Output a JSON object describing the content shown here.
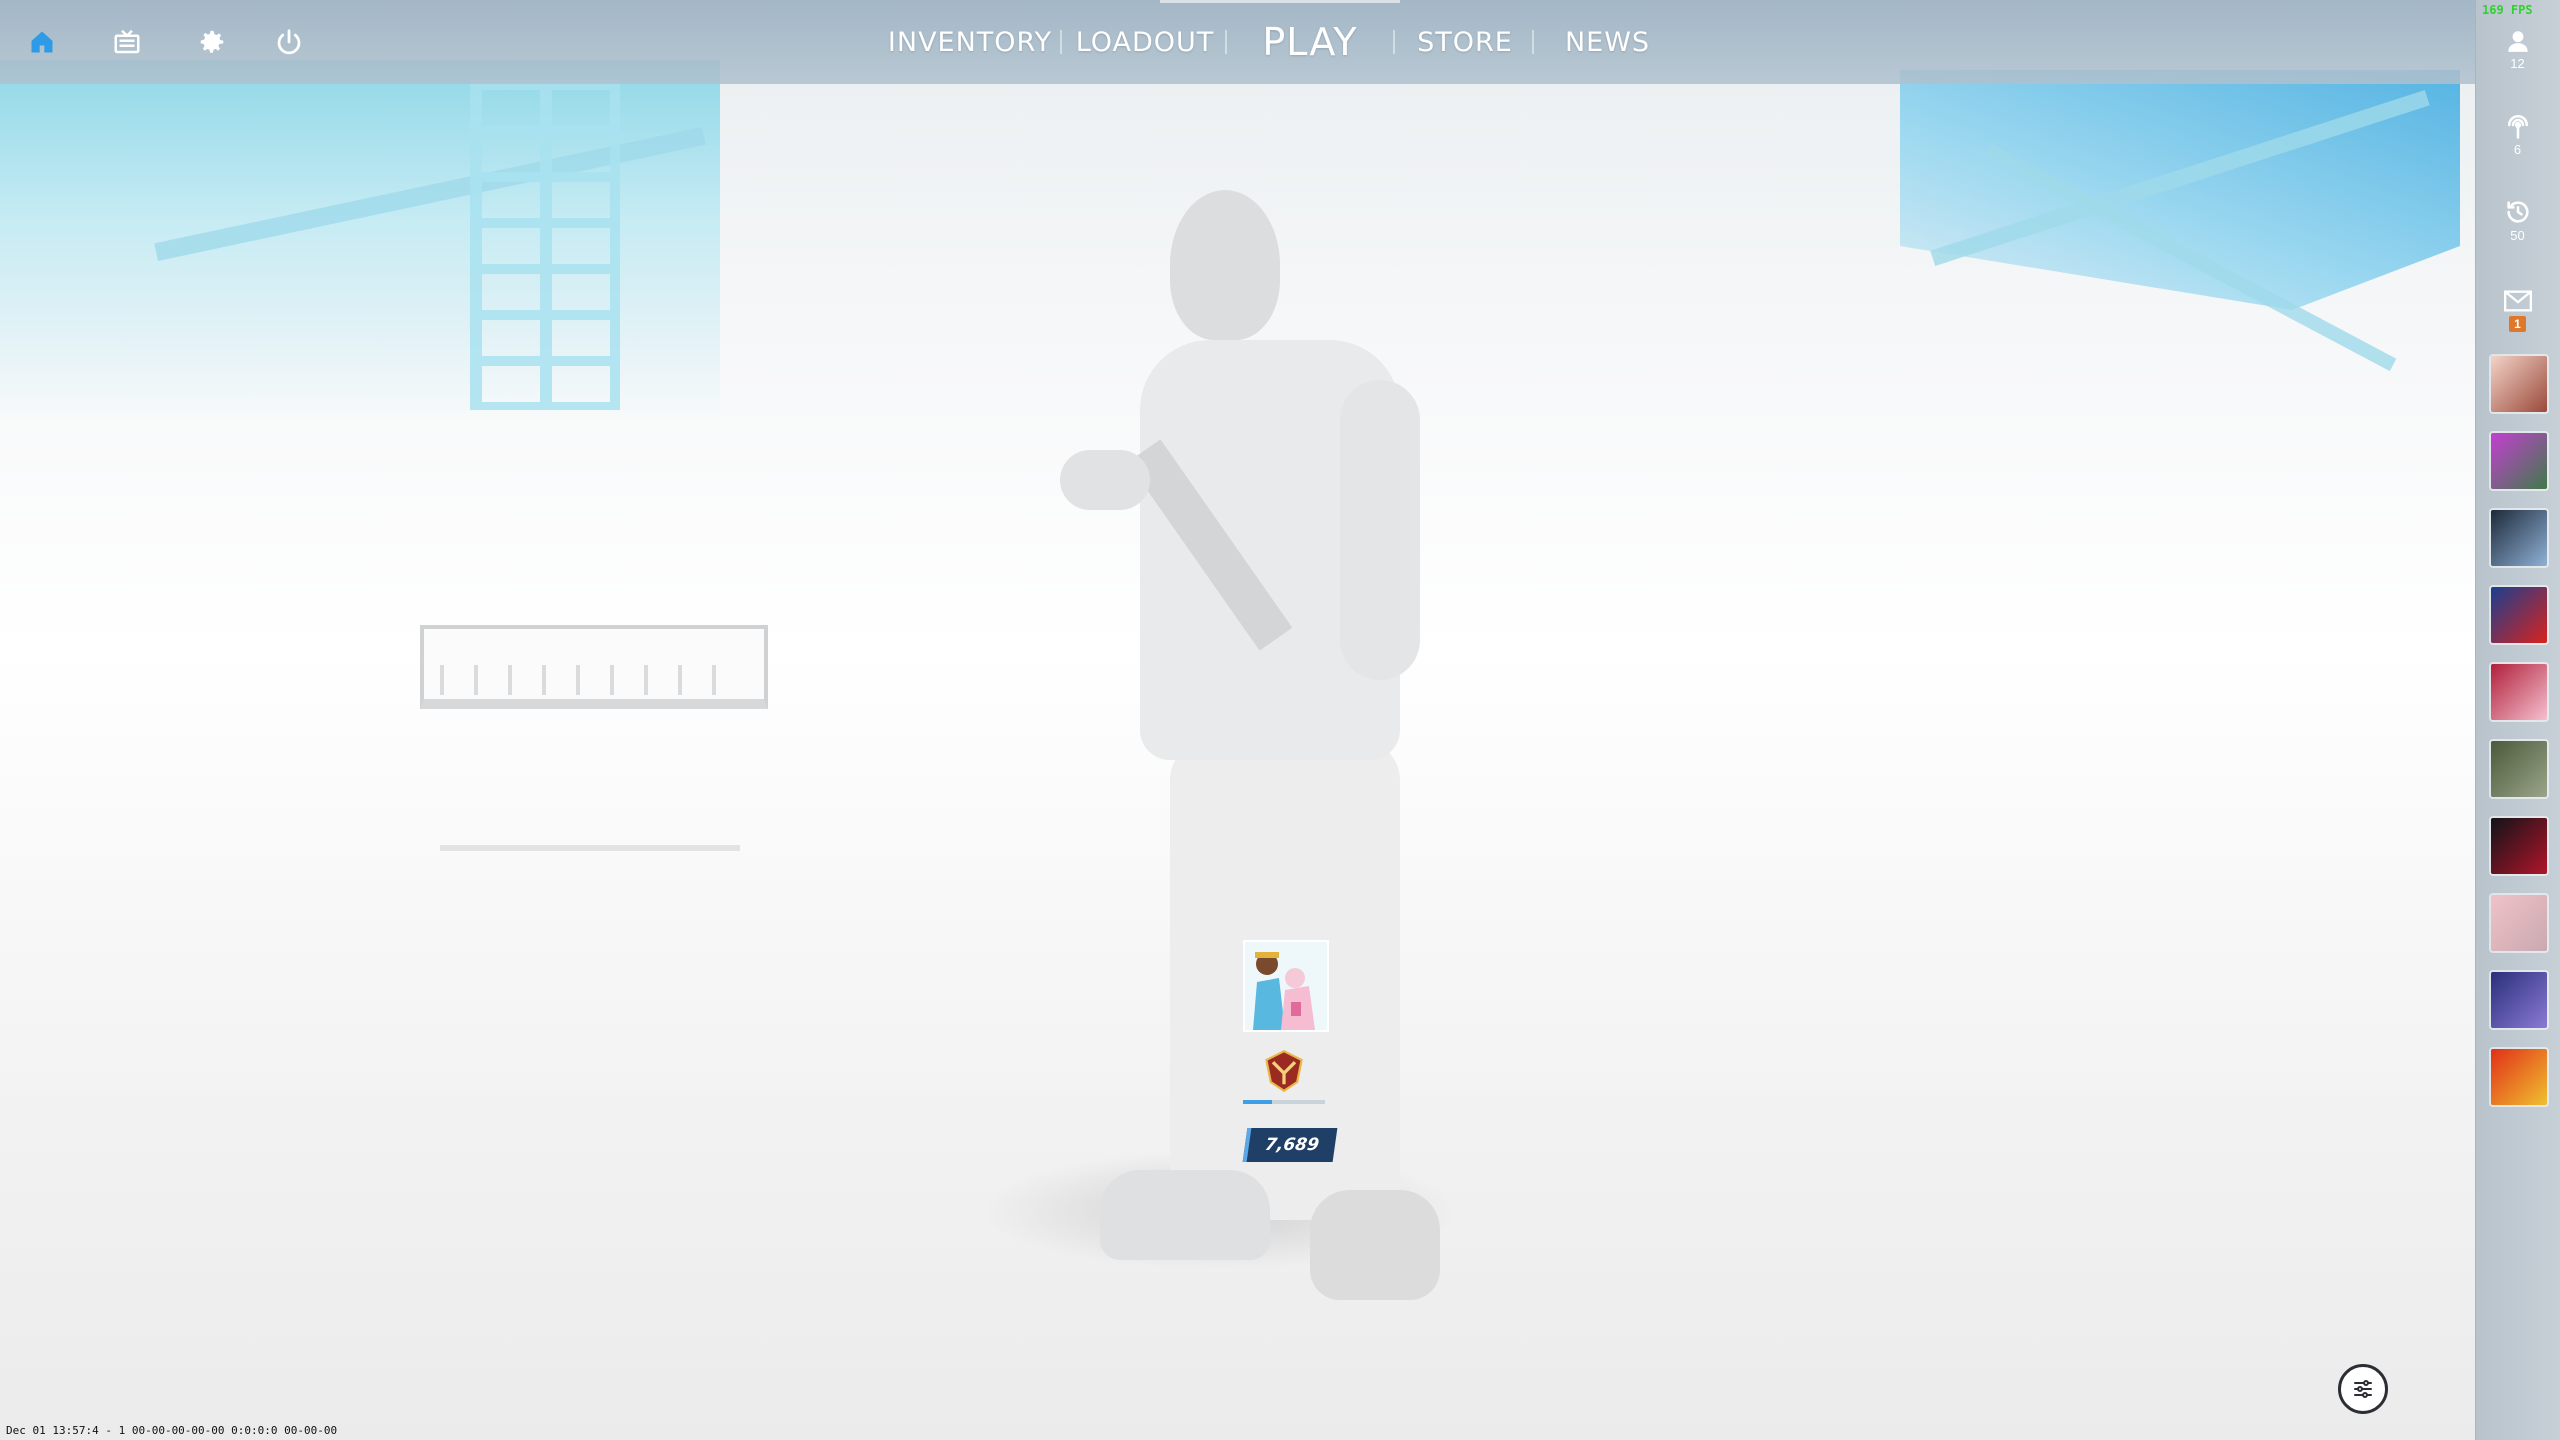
{
  "top_nav": {
    "left_icons": [
      "home-icon",
      "tv-icon",
      "gear-icon",
      "power-icon"
    ],
    "tabs": [
      {
        "label": "INVENTORY",
        "active": false
      },
      {
        "label": "LOADOUT",
        "active": false
      },
      {
        "label": "PLAY",
        "active": true
      },
      {
        "label": "STORE",
        "active": false
      },
      {
        "label": "NEWS",
        "active": false
      }
    ]
  },
  "right_rail": {
    "fps": "169 FPS",
    "friends": {
      "icon": "user-icon",
      "count": "12"
    },
    "party": {
      "icon": "broadcast-icon",
      "count": "6"
    },
    "history": {
      "icon": "history-icon",
      "count": "50"
    },
    "mail": {
      "icon": "mail-icon",
      "badge": "1"
    },
    "avatars": [
      {
        "colors": [
          "#f3d3c8",
          "#9a4a3a"
        ]
      },
      {
        "colors": [
          "#c43fd1",
          "#3f7a4a"
        ]
      },
      {
        "colors": [
          "#1d2a3a",
          "#8fb1d6"
        ]
      },
      {
        "colors": [
          "#1a3f8f",
          "#d8231f"
        ]
      },
      {
        "colors": [
          "#b0203a",
          "#f5c0d0"
        ]
      },
      {
        "colors": [
          "#4b5a3a",
          "#9aa48a"
        ]
      },
      {
        "colors": [
          "#111418",
          "#b0152a"
        ]
      },
      {
        "colors": [
          "#f0c2c8",
          "#c9a9b0"
        ]
      },
      {
        "colors": [
          "#2a2f7a",
          "#8a7ad6"
        ]
      },
      {
        "colors": [
          "#e03018",
          "#f0c030"
        ]
      }
    ]
  },
  "player_card": {
    "credits": "7,689",
    "xp_progress": 0.35,
    "rank_icon": "rank-emblem-icon"
  },
  "bottom": {
    "filter_icon": "sliders-icon",
    "debug_text": "Dec 01 13:57:4 - 1 00-00-00-00-00 0:0:0:0 00-00-00"
  }
}
